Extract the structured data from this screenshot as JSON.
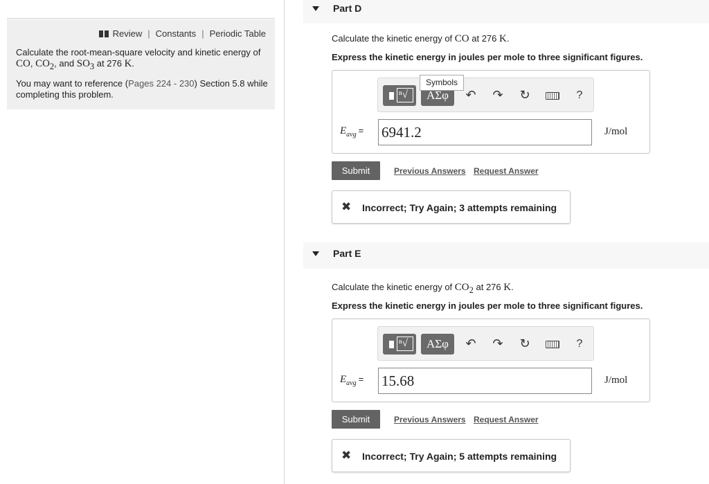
{
  "left": {
    "links": [
      "Review",
      "Constants",
      "Periodic Table"
    ],
    "intro_prefix": "Calculate the root-mean-square velocity and kinetic energy of",
    "species": [
      "CO",
      "CO",
      "2",
      "SO",
      "3"
    ],
    "intro_and": "and",
    "intro_at": "at 276",
    "temp_unit": "K",
    "ref_prefix": "You may want to reference (",
    "ref_pages": "Pages 224 - 230",
    "ref_suffix": ") Section 5.8 while completing this problem."
  },
  "parts": [
    {
      "title": "Part D",
      "question_prefix": "Calculate the kinetic energy of",
      "species": "CO",
      "species_sub": "",
      "question_at": "at 276",
      "temp_unit": "K",
      "instruction": "Express the kinetic energy in joules per mole to three significant figures.",
      "show_tooltip": true,
      "tooltip": "Symbols",
      "sym_label": "ΑΣφ",
      "var": "E",
      "var_sub": "avg",
      "eq": "=",
      "answer_value": "6941.2",
      "unit": "J/mol",
      "submit": "Submit",
      "prev_answers": "Previous Answers",
      "request_answer": "Request Answer",
      "feedback": "Incorrect; Try Again; 3 attempts remaining"
    },
    {
      "title": "Part E",
      "question_prefix": "Calculate the kinetic energy of",
      "species": "CO",
      "species_sub": "2",
      "question_at": "at 276",
      "temp_unit": "K",
      "instruction": "Express the kinetic energy in joules per mole to three significant figures.",
      "show_tooltip": false,
      "tooltip": "",
      "sym_label": "ΑΣφ",
      "var": "E",
      "var_sub": "avg",
      "eq": "=",
      "answer_value": "15.68",
      "unit": "J/mol",
      "submit": "Submit",
      "prev_answers": "Previous Answers",
      "request_answer": "Request Answer",
      "feedback": "Incorrect; Try Again; 5 attempts remaining"
    }
  ],
  "icons": {
    "undo": "undo-icon",
    "redo": "redo-icon",
    "reset": "reset-icon",
    "keyboard": "keyboard-icon",
    "help": "help-icon"
  },
  "help_label": "?",
  "colors": {
    "button_gray": "#636363",
    "panel_bg": "#efefef"
  }
}
